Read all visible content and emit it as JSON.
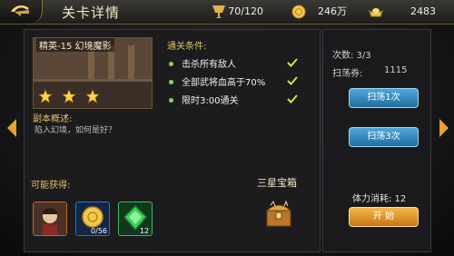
{
  "header": {
    "title": "关卡详情",
    "stamina": "70/120",
    "gold": "246万",
    "silver": "2483"
  },
  "stage": {
    "name": "精英-15 幻境魔影",
    "stars": 3,
    "summary_label": "副本概述:",
    "summary": "陷入幻境，如何是好？"
  },
  "conditions": {
    "label": "通关条件:",
    "items": [
      {
        "text": "击杀所有敌人",
        "done": true
      },
      {
        "text": "全部武将血高于70%",
        "done": true
      },
      {
        "text": "限时3:00通关",
        "done": true
      }
    ]
  },
  "rewards": {
    "label": "可能获得:",
    "items": [
      {
        "icon": "general-portrait-icon",
        "count": ""
      },
      {
        "icon": "gold-coin-icon",
        "count": "0/56"
      },
      {
        "icon": "green-jade-icon",
        "count": "12"
      }
    ],
    "chest_label": "三星宝箱",
    "chest_icon": "treasure-chest-icon"
  },
  "side": {
    "attempts": "次数: 3/3",
    "sweep_tickets": "扫荡券:",
    "sweep_count": "1115",
    "sweep1": "扫荡1次",
    "sweep3": "扫荡3次",
    "cost": "体力消耗: 12",
    "start": "开 始"
  },
  "colors": {
    "accent_gold": "#e2c06a",
    "check_green": "#9ad24a",
    "button_blue": "#2f8fc8",
    "button_orange": "#e19a2b"
  }
}
